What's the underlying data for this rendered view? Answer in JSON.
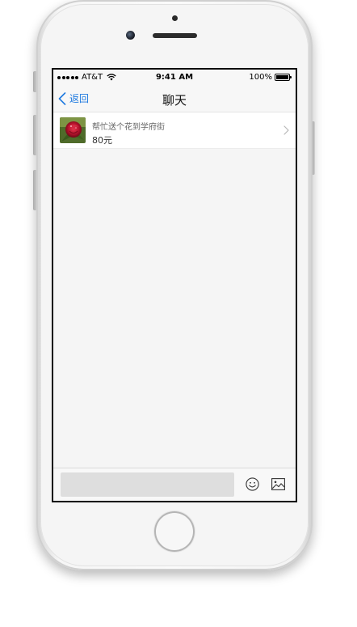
{
  "status_bar": {
    "carrier": "AT&T",
    "time": "9:41 AM",
    "battery": "100%"
  },
  "nav": {
    "back_label": "返回",
    "title": "聊天"
  },
  "item": {
    "title": "帮忙送个花到学府街",
    "price": "80元"
  },
  "input": {
    "value": "",
    "placeholder": ""
  },
  "icons": {
    "back": "chevron-left-icon",
    "item_arrow": "chevron-right-icon",
    "emoji": "smiley-icon",
    "image": "image-icon"
  },
  "colors": {
    "accent": "#1f7ae0",
    "background": "#f5f5f5",
    "input_fill": "#dedede"
  }
}
